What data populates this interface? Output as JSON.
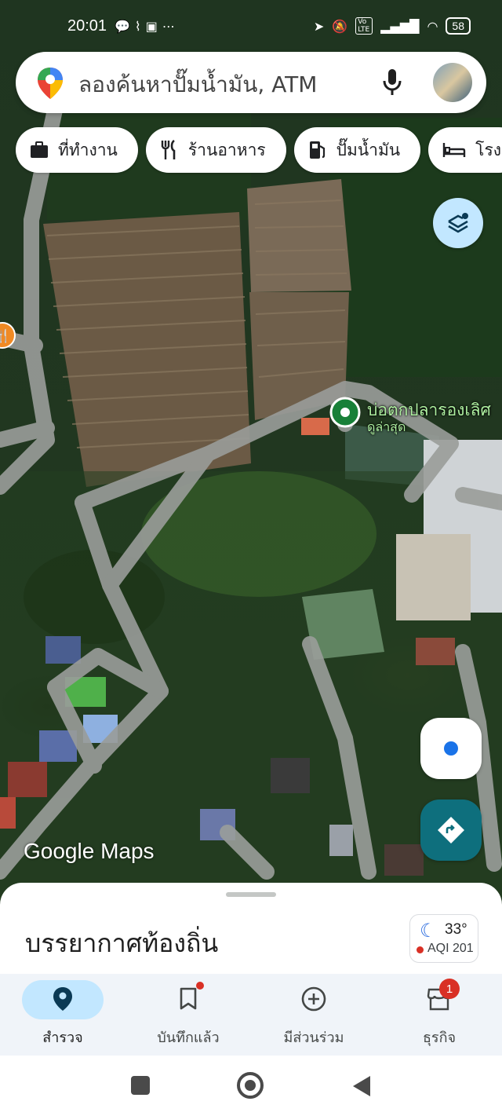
{
  "status_bar": {
    "time": "20:01",
    "left_icons": [
      "chat-bubble-icon",
      "washing-icon",
      "bus-icon",
      "more-icon"
    ],
    "right_icons": [
      "location-arrow-icon",
      "mute-bell-icon",
      "volte-icon",
      "signal-icon",
      "wifi-icon"
    ],
    "volte": "Vo LTE",
    "battery": "58"
  },
  "search": {
    "placeholder": "ลองค้นหาปั๊มน้ำมัน, ATM"
  },
  "chips": [
    {
      "icon": "briefcase-icon",
      "label": "ที่ทำงาน"
    },
    {
      "icon": "restaurant-icon",
      "label": "ร้านอาหาร"
    },
    {
      "icon": "gas-station-icon",
      "label": "ปั๊มน้ำมัน"
    },
    {
      "icon": "hotel-icon",
      "label": "โรง"
    }
  ],
  "place": {
    "name": "บ่อตกปลารองเลิศ",
    "sub": "ดูล่าสุด"
  },
  "watermark": "Google Maps",
  "sheet": {
    "title": "บรรยากาศท้องถิ่น",
    "weather": {
      "temp": "33°",
      "aqi": "AQI 201",
      "icon": "moon-icon"
    }
  },
  "nav": [
    {
      "label": "สำรวจ",
      "icon": "explore-pin-icon",
      "active": true
    },
    {
      "label": "บันทึกแล้ว",
      "icon": "bookmark-icon",
      "active": false
    },
    {
      "label": "มีส่วนร่วม",
      "icon": "add-circle-icon",
      "active": false
    },
    {
      "label": "ธุรกิจ",
      "icon": "store-icon",
      "active": false
    }
  ],
  "business_badge": "1",
  "colors": {
    "accent": "#c2e7ff",
    "directions": "#0e6f7d",
    "place_pin": "#188038",
    "badge": "#d93025"
  }
}
